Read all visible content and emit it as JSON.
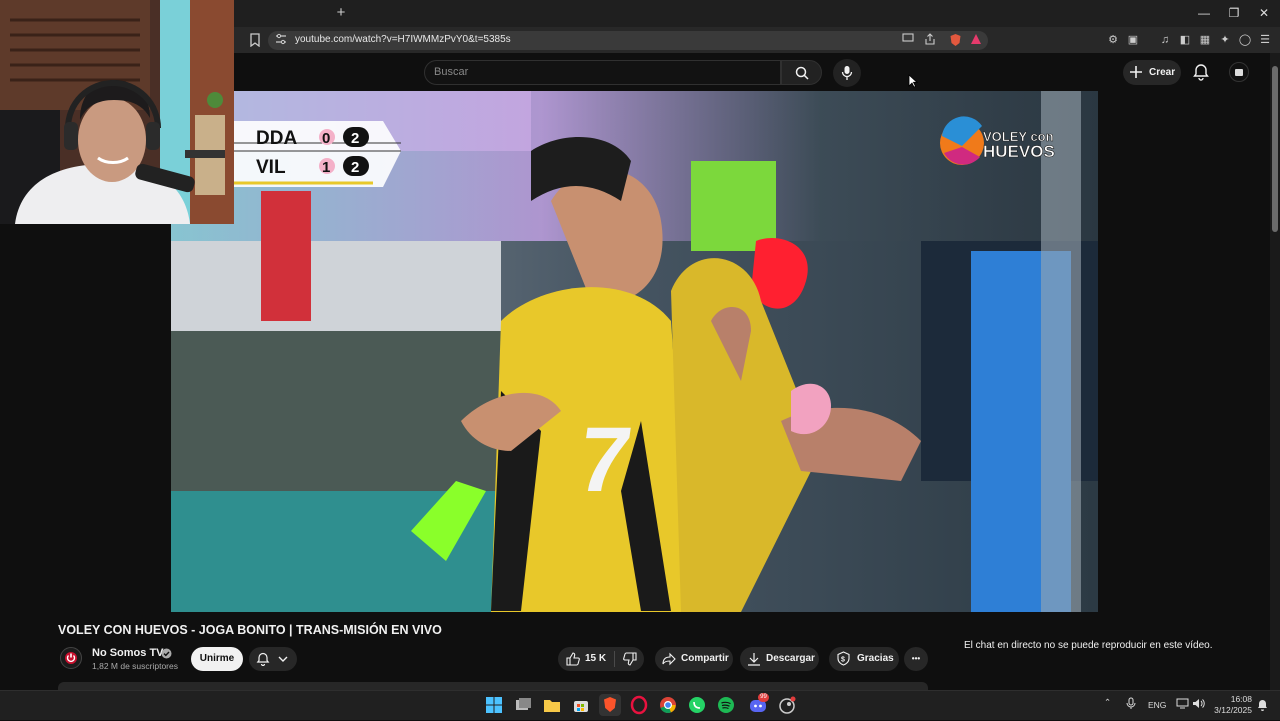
{
  "browser": {
    "url": "youtube.com/watch?v=H7IWMMzPvY0&t=5385s",
    "new_tab_label": "+"
  },
  "youtube": {
    "search_placeholder": "Buscar",
    "create_label": "Crear"
  },
  "video": {
    "scoreboard": [
      {
        "team": "DDA",
        "sets": "0",
        "points": "2"
      },
      {
        "team": "VIL",
        "sets": "1",
        "points": "2"
      }
    ],
    "logo_line1": "VOLEY con",
    "logo_line2": "HUEVOS",
    "jersey_number": "7",
    "title": "VOLEY CON HUEVOS - JOGA BONITO | TRANS-MISIÓN EN VIVO"
  },
  "channel": {
    "name": "No Somos TV",
    "subscribers": "1,82 M de suscriptores",
    "join_label": "Unirme"
  },
  "actions": {
    "likes": "15 K",
    "share_label": "Compartir",
    "download_label": "Descargar",
    "thanks_label": "Gracias",
    "more_label": "•••"
  },
  "chat": {
    "notice": "El chat en directo no se puede reproducir en este vídeo."
  },
  "taskbar": {
    "language": "ENG",
    "time": "16:08",
    "date": "3/12/2025",
    "discord_badge": "99"
  }
}
